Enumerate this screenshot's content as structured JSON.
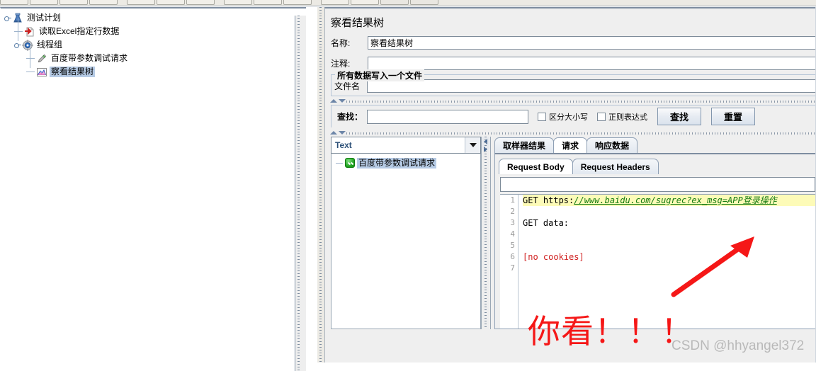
{
  "toolbar": {
    "button_count": 15
  },
  "tree": {
    "nodes": [
      {
        "label": "测试计划",
        "icon": "test-plan-icon",
        "depth": 0,
        "selected": false
      },
      {
        "label": "读取Excel指定行数据",
        "icon": "csv-data-set-icon",
        "depth": 1,
        "selected": false
      },
      {
        "label": "线程组",
        "icon": "thread-group-icon",
        "depth": 1,
        "selected": false
      },
      {
        "label": "百度带参数调试请求",
        "icon": "http-request-icon",
        "depth": 2,
        "selected": false
      },
      {
        "label": "察看结果树",
        "icon": "view-results-tree-icon",
        "depth": 2,
        "selected": true
      }
    ]
  },
  "panel": {
    "title": "察看结果树",
    "name_label": "名称:",
    "name_value": "察看结果树",
    "comment_label": "注释:",
    "comment_value": "",
    "filegroup_legend": "所有数据写入一个文件",
    "filename_label": "文件名",
    "filename_value": ""
  },
  "search": {
    "label": "查找：",
    "value": "",
    "case_sensitive_label": "区分大小写",
    "case_sensitive_checked": false,
    "regex_label": "正则表达式",
    "regex_checked": false,
    "find_button": "查找",
    "reset_button": "重置"
  },
  "results": {
    "renderer_selected": "Text",
    "sampler_label": "百度带参数调试请求",
    "sampler_status": "success"
  },
  "tabs": {
    "outer": [
      {
        "label": "取样器结果",
        "active": false
      },
      {
        "label": "请求",
        "active": true
      },
      {
        "label": "响应数据",
        "active": false
      }
    ],
    "inner": [
      {
        "label": "Request Body",
        "active": true
      },
      {
        "label": "Request Headers",
        "active": false
      }
    ]
  },
  "code": {
    "search_value": "",
    "line_numbers": [
      "1",
      "2",
      "3",
      "4",
      "5",
      "6",
      "7"
    ],
    "lines": [
      {
        "n": "1",
        "highlight": true,
        "parts": [
          {
            "text": "GET https:",
            "style": "black"
          },
          {
            "text": "//www.baidu.com/sugrec?ex_msg=APP登录操作",
            "style": "green"
          }
        ]
      },
      {
        "n": "2",
        "highlight": false,
        "parts": []
      },
      {
        "n": "3",
        "highlight": false,
        "parts": [
          {
            "text": "GET data:",
            "style": "black"
          }
        ]
      },
      {
        "n": "4",
        "highlight": false,
        "parts": []
      },
      {
        "n": "5",
        "highlight": false,
        "parts": []
      },
      {
        "n": "6",
        "highlight": false,
        "parts": [
          {
            "text": "[no cookies]",
            "style": "red"
          }
        ]
      },
      {
        "n": "7",
        "highlight": false,
        "parts": []
      }
    ]
  },
  "annotation": {
    "text": "你看！！！",
    "arrow_color": "#f51717",
    "watermark": "CSDN @hhyangel372"
  },
  "colors": {
    "highlight_yellow": "#fdfbb8",
    "selection_blue": "#b6cbe5",
    "link_green": "#127a12",
    "error_red": "#d02020",
    "panel_grey": "#efefef"
  }
}
